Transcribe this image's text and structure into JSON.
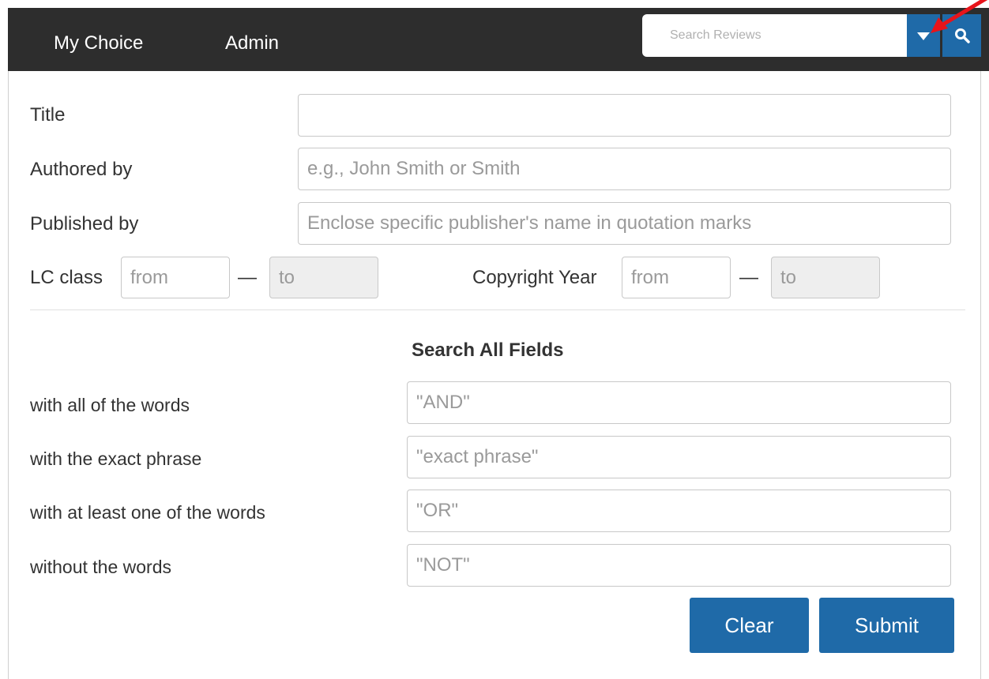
{
  "nav": {
    "items": [
      {
        "label": "My Choice"
      },
      {
        "label": "Admin"
      }
    ]
  },
  "search": {
    "placeholder": "Search Reviews",
    "dropdown_icon": "caret-down-icon",
    "search_icon": "magnifier-icon"
  },
  "form": {
    "title_label": "Title",
    "title_value": "",
    "author_label": "Authored by",
    "author_placeholder": "e.g., John Smith or Smith",
    "publisher_label": "Published by",
    "publisher_placeholder": "Enclose specific publisher's name in quotation marks",
    "lc_label": "LC class",
    "lc_from_placeholder": "from",
    "lc_to_placeholder": "to",
    "copyright_label": "Copyright Year",
    "copyright_from_placeholder": "from",
    "copyright_to_placeholder": "to",
    "dash": "—"
  },
  "all_fields": {
    "title": "Search All Fields",
    "rows": [
      {
        "label": "with all of the words",
        "placeholder": "\"AND\""
      },
      {
        "label": "with the exact phrase",
        "placeholder": "\"exact phrase\""
      },
      {
        "label": "with at least one of the words",
        "placeholder": "\"OR\""
      },
      {
        "label": "without the words",
        "placeholder": "\"NOT\""
      }
    ]
  },
  "buttons": {
    "clear": "Clear",
    "submit": "Submit"
  },
  "colors": {
    "topbar": "#2d2d2d",
    "accent": "#1f6aa8",
    "annotation_arrow": "#e8141b"
  }
}
